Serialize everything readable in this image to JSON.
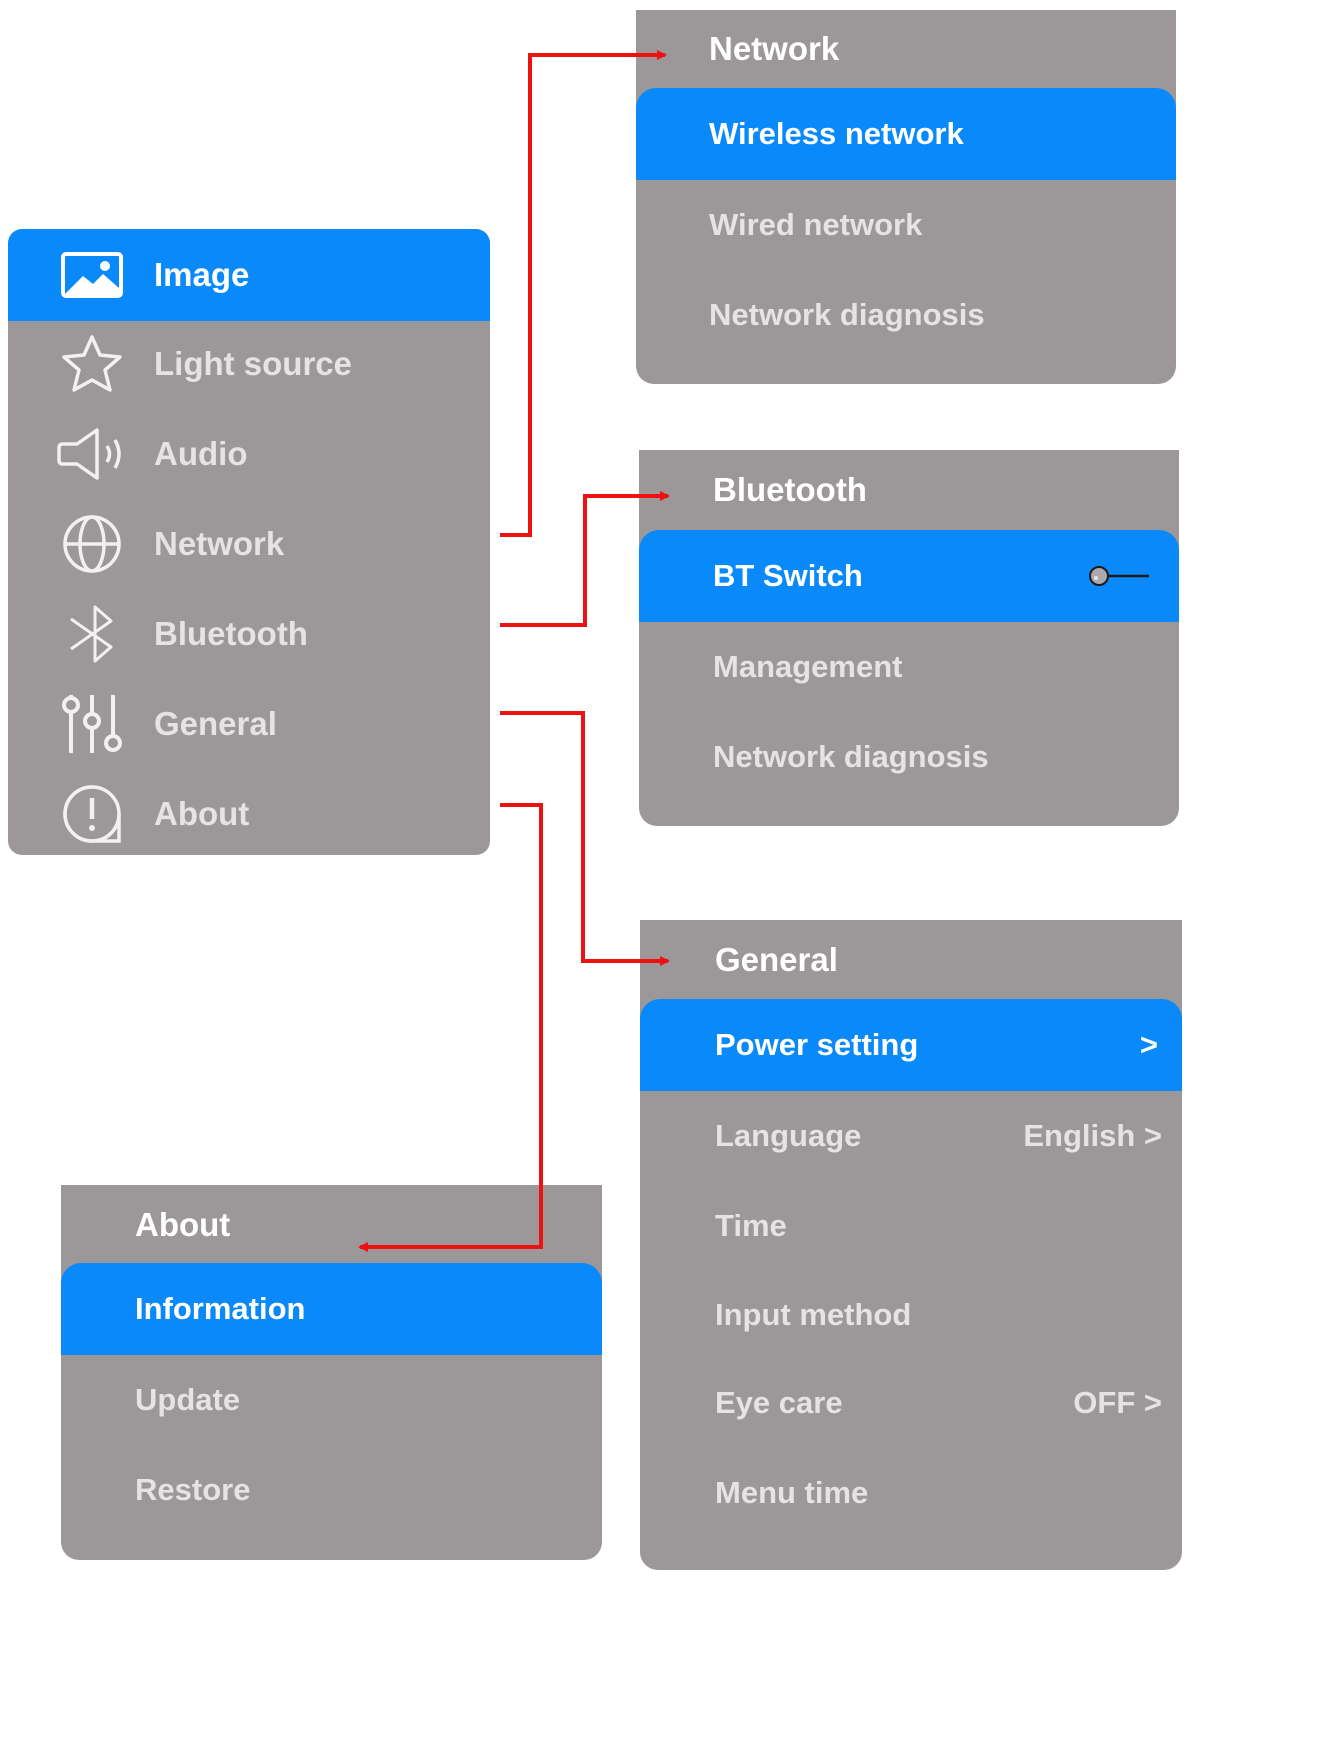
{
  "main_menu": {
    "items": [
      {
        "label": "Image",
        "icon": "image-icon",
        "selected": true
      },
      {
        "label": "Light source",
        "icon": "star-icon",
        "selected": false
      },
      {
        "label": "Audio",
        "icon": "speaker-icon",
        "selected": false
      },
      {
        "label": "Network",
        "icon": "globe-icon",
        "selected": false
      },
      {
        "label": "Bluetooth",
        "icon": "bluetooth-icon",
        "selected": false
      },
      {
        "label": "General",
        "icon": "sliders-icon",
        "selected": false
      },
      {
        "label": "About",
        "icon": "info-icon",
        "selected": false
      }
    ]
  },
  "network_menu": {
    "title": "Network",
    "items": [
      {
        "label": "Wireless network",
        "selected": true
      },
      {
        "label": "Wired network",
        "selected": false
      },
      {
        "label": "Network diagnosis",
        "selected": false
      }
    ]
  },
  "bluetooth_menu": {
    "title": "Bluetooth",
    "items": [
      {
        "label": "BT Switch",
        "selected": true,
        "toggle": "off"
      },
      {
        "label": "Management",
        "selected": false
      },
      {
        "label": "Network diagnosis",
        "selected": false
      }
    ]
  },
  "general_menu": {
    "title": "General",
    "items": [
      {
        "label": "Power setting",
        "value": ">",
        "selected": true
      },
      {
        "label": "Language",
        "value": "English >",
        "selected": false
      },
      {
        "label": "Time",
        "value": "",
        "selected": false
      },
      {
        "label": "Input method",
        "value": "",
        "selected": false
      },
      {
        "label": "Eye care",
        "value": "OFF >",
        "selected": false
      },
      {
        "label": "Menu time",
        "value": "",
        "selected": false
      }
    ]
  },
  "about_menu": {
    "title": "About",
    "items": [
      {
        "label": "Information",
        "selected": true
      },
      {
        "label": "Update",
        "selected": false
      },
      {
        "label": "Restore",
        "selected": false
      }
    ]
  },
  "colors": {
    "panel": "#9c9899",
    "selected": "#0a8afa",
    "connector": "#ee1111",
    "text": "#e6e3e4"
  }
}
